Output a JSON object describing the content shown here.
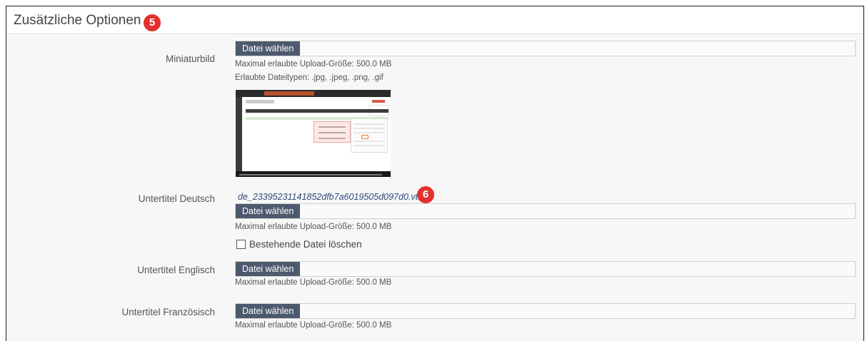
{
  "section": {
    "title": "Zusätzliche Optionen",
    "title_badge": "5"
  },
  "fields": [
    {
      "label": "Miniaturbild",
      "button_label": "Datei wählen",
      "max_size_hint": "Maximal erlaubte Upload-Größe: 500.0 MB",
      "file_types_hint": "Erlaubte Dateitypen: .jpg, .jpeg, .png, .gif"
    },
    {
      "label": "Untertitel Deutsch",
      "current_file": "de_23395231141852dfb7a6019505d097d0.vtt",
      "file_badge": "6",
      "button_label": "Datei wählen",
      "max_size_hint": "Maximal erlaubte Upload-Größe: 500.0 MB",
      "delete_checkbox_label": "Bestehende Datei löschen",
      "delete_checked": false
    },
    {
      "label": "Untertitel Englisch",
      "button_label": "Datei wählen",
      "max_size_hint": "Maximal erlaubte Upload-Größe: 500.0 MB"
    },
    {
      "label": "Untertitel Französisch",
      "button_label": "Datei wählen",
      "max_size_hint": "Maximal erlaubte Upload-Größe: 500.0 MB"
    }
  ],
  "colors": {
    "badge": "#e3312d",
    "button_bg": "#4d5a6e",
    "link": "#2e4a7a"
  }
}
